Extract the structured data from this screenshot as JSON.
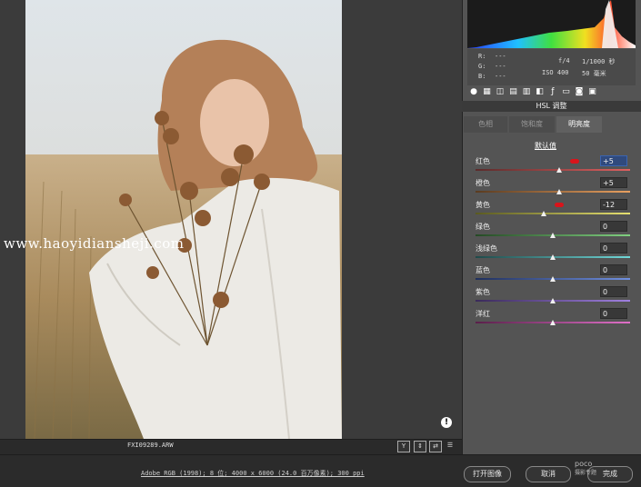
{
  "image": {
    "filename": "FXI09289.ARW",
    "watermark": "www.haoyidiansheji.com"
  },
  "info": {
    "r_label": "R:",
    "g_label": "G:",
    "b_label": "B:",
    "r_value": "---",
    "g_value": "---",
    "b_value": "---",
    "aperture": "f/4",
    "shutter": "1/1000 秒",
    "iso": "ISO 400",
    "focal": "50 毫米"
  },
  "panel": {
    "section_title": "HSL 调整",
    "tabs": [
      {
        "label": "色相"
      },
      {
        "label": "饱和度"
      },
      {
        "label": "明亮度"
      }
    ],
    "active_tab": "明亮度",
    "default_label": "默认值",
    "sliders": [
      {
        "label": "红色",
        "value": "+5",
        "pos": 0.54,
        "gradient": [
          "#5b2b2b",
          "#e06060"
        ],
        "selected": true,
        "marked": true
      },
      {
        "label": "橙色",
        "value": "+5",
        "pos": 0.54,
        "gradient": [
          "#5a3b20",
          "#e8a060"
        ],
        "selected": false,
        "marked": false
      },
      {
        "label": "黄色",
        "value": "-12",
        "pos": 0.44,
        "gradient": [
          "#5a5a20",
          "#e6e070"
        ],
        "selected": false,
        "marked": true
      },
      {
        "label": "绿色",
        "value": "0",
        "pos": 0.5,
        "gradient": [
          "#254a25",
          "#80d080"
        ],
        "selected": false,
        "marked": false
      },
      {
        "label": "浅绿色",
        "value": "0",
        "pos": 0.5,
        "gradient": [
          "#1f4a4a",
          "#70d8d8"
        ],
        "selected": false,
        "marked": false
      },
      {
        "label": "蓝色",
        "value": "0",
        "pos": 0.5,
        "gradient": [
          "#1f2f5c",
          "#7090e0"
        ],
        "selected": false,
        "marked": false
      },
      {
        "label": "紫色",
        "value": "0",
        "pos": 0.5,
        "gradient": [
          "#3a2a5a",
          "#a080e0"
        ],
        "selected": false,
        "marked": false
      },
      {
        "label": "洋红",
        "value": "0",
        "pos": 0.5,
        "gradient": [
          "#5a1f4a",
          "#e070c8"
        ],
        "selected": false,
        "marked": false
      }
    ]
  },
  "toolbar_icons": [
    "aperture-icon",
    "grid-icon",
    "tone-curve-icon",
    "detail-icon",
    "hsl-icon",
    "split-toning-icon",
    "fx-icon",
    "lens-icon",
    "calibration-icon",
    "presets-icon"
  ],
  "bottom": {
    "workflow_text": "Adobe RGB (1998); 8 位; 4000 x 6000 (24.0 百万像素); 300 ppi",
    "open_image": "打开图像",
    "cancel": "取消",
    "done": "完成",
    "brand": "poco",
    "brand_sub": "摄影专题"
  },
  "view_buttons": [
    "Y",
    "compare-icon",
    "swap-icon",
    "settings-icon"
  ]
}
